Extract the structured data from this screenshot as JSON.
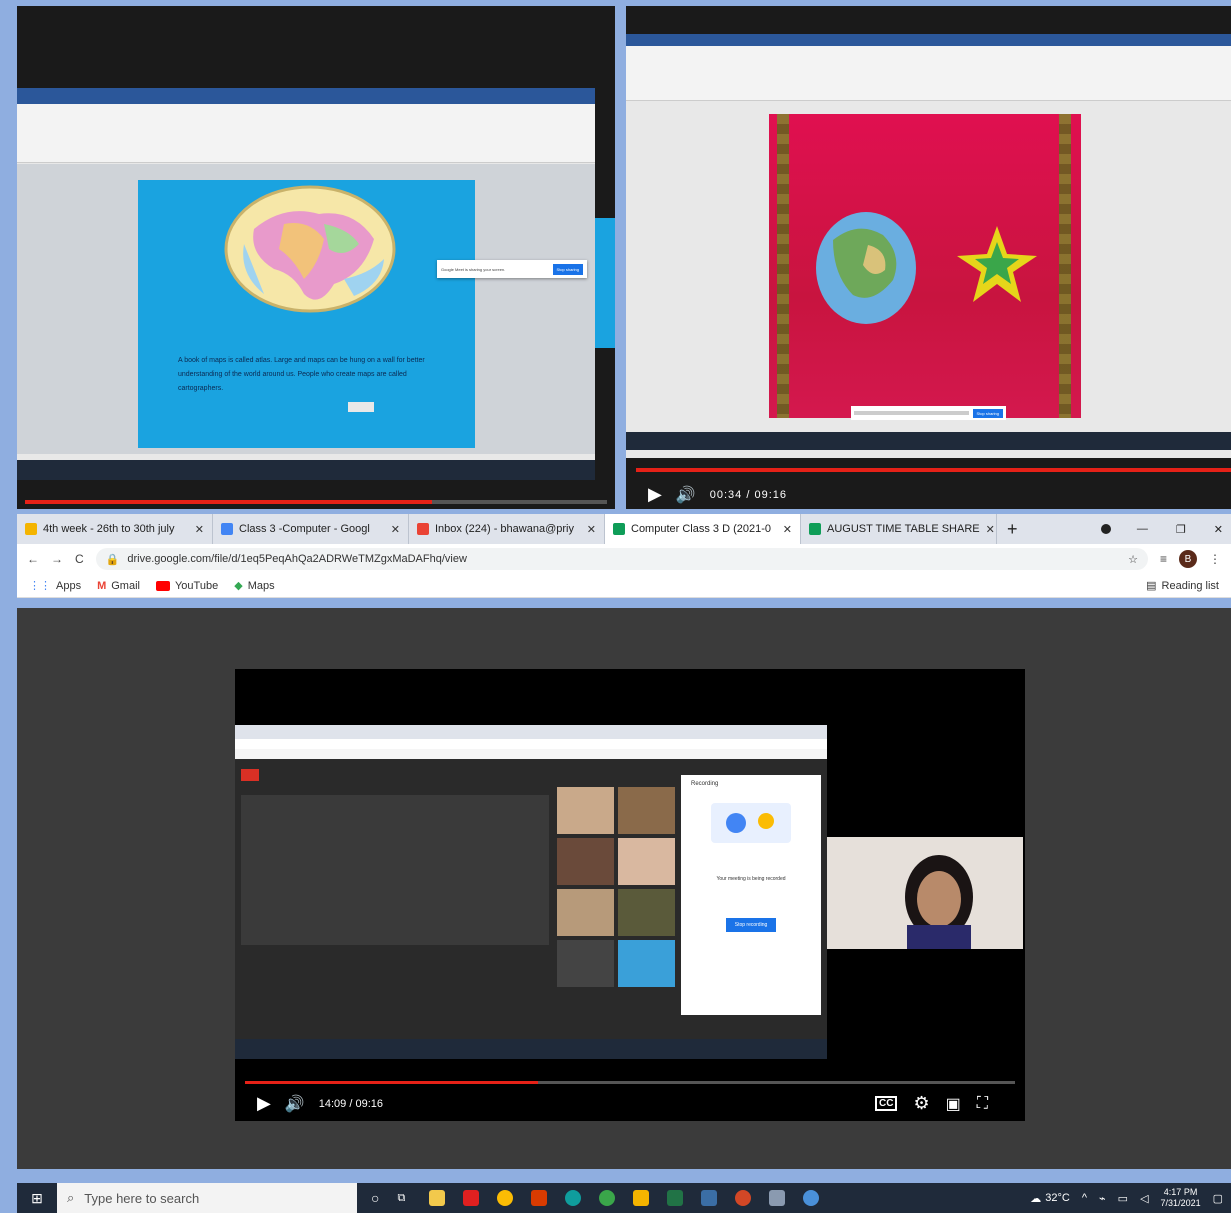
{
  "left_video": {
    "caption": "A book of maps is called atlas. Large and maps can be hung on a wall for better understanding of the world around us. People who create maps are called cartographers.",
    "dialog_text": "Google Meet is sharing your screen.",
    "dialog_button": "Stop sharing",
    "progress_percent": 70
  },
  "right_video": {
    "time": "00:34 / 09:16",
    "dialog_button": "Stop sharing",
    "progress_percent": 100
  },
  "browser": {
    "tabs": [
      {
        "label": "4th week - 26th to 30th july",
        "color": "#f4b400"
      },
      {
        "label": "Class 3 -Computer - Googl",
        "color": "#4285f4"
      },
      {
        "label": "Inbox (224) - bhawana@priy",
        "color": "#ea4335"
      },
      {
        "label": "Computer Class 3 D (2021-0",
        "color": "#0f9d58"
      },
      {
        "label": "AUGUST TIME TABLE SHARE",
        "color": "#0f9d58"
      }
    ],
    "new_tab": "+",
    "url": "drive.google.com/file/d/1eq5PeqAhQa2ADRWeTMZgxMaDAFhq/view",
    "bookmarks": [
      {
        "label": "Apps",
        "color": "#4285f4"
      },
      {
        "label": "Gmail",
        "color": "#ea4335"
      },
      {
        "label": "YouTube",
        "color": "#ff0000"
      },
      {
        "label": "Maps",
        "color": "#34a853"
      }
    ],
    "reading_list": "Reading list"
  },
  "main_video": {
    "time": "14:09 / 09:16",
    "progress_percent": 38,
    "inner_recording_title": "Recording",
    "inner_recording_text": "Your meeting is being recorded",
    "inner_stop_button": "Stop recording"
  },
  "taskbar": {
    "search_placeholder": "Type here to search",
    "weather": "32°C",
    "time": "4:17 PM",
    "date": "7/31/2021"
  },
  "colors": {
    "accent_red": "#e62117",
    "desktop_blue": "#8faee0",
    "taskbar_bg": "#1f2a3a"
  }
}
